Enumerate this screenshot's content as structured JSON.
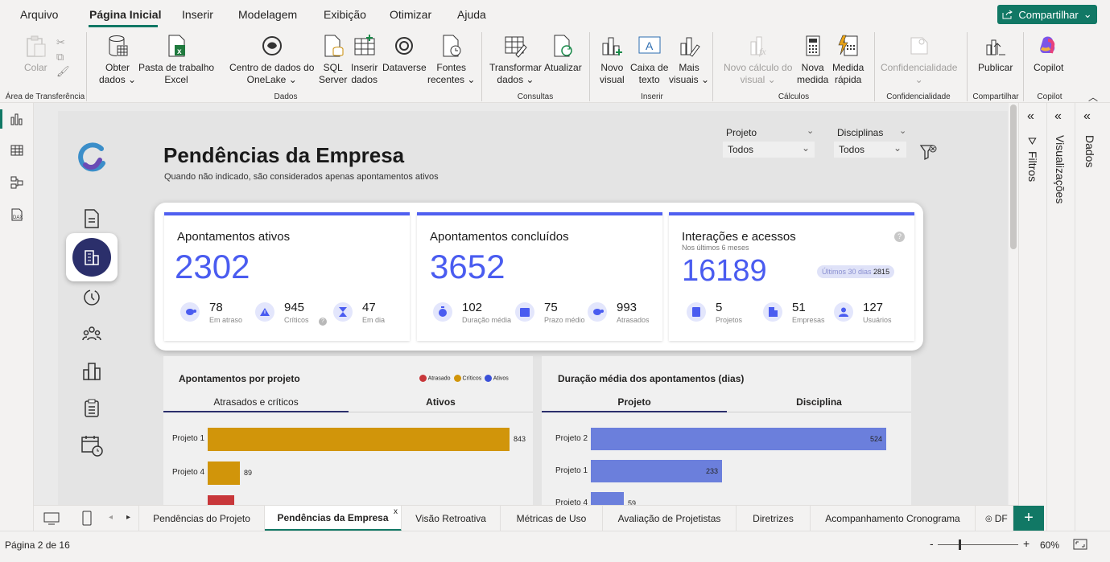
{
  "menu": {
    "items": [
      "Arquivo",
      "Página Inicial",
      "Inserir",
      "Modelagem",
      "Exibição",
      "Otimizar",
      "Ajuda"
    ],
    "share": "Compartilhar"
  },
  "ribbon": {
    "buttons": [
      {
        "l1": "Colar",
        "l2": "",
        "icon": "paste-icon"
      },
      {
        "l1": "Obter",
        "l2": "dados ⌄",
        "icon": "database-icon"
      },
      {
        "l1": "Pasta de trabalho",
        "l2": "Excel",
        "icon": "excel-icon"
      },
      {
        "l1": "Centro de dados do",
        "l2": "OneLake ⌄",
        "icon": "onelake-icon"
      },
      {
        "l1": "SQL",
        "l2": "Server",
        "icon": "sql-server-icon"
      },
      {
        "l1": "Inserir",
        "l2": "dados",
        "icon": "table-icon"
      },
      {
        "l1": "Dataverse",
        "l2": "",
        "icon": "dataverse-icon"
      },
      {
        "l1": "Fontes",
        "l2": "recentes ⌄",
        "icon": "recent-icon"
      },
      {
        "l1": "Transformar",
        "l2": "dados ⌄",
        "icon": "transform-icon"
      },
      {
        "l1": "Atualizar",
        "l2": "",
        "icon": "refresh-icon"
      },
      {
        "l1": "Novo",
        "l2": "visual",
        "icon": "new-visual-icon"
      },
      {
        "l1": "Caixa de",
        "l2": "texto",
        "icon": "textbox-icon"
      },
      {
        "l1": "Mais",
        "l2": "visuais ⌄",
        "icon": "more-visuals-icon"
      },
      {
        "l1": "Novo cálculo do",
        "l2": "visual ⌄",
        "icon": "visual-calc-icon"
      },
      {
        "l1": "Nova",
        "l2": "medida",
        "icon": "measure-icon"
      },
      {
        "l1": "Medida",
        "l2": "rápida",
        "icon": "quick-measure-icon"
      },
      {
        "l1": "Confidencialidade",
        "l2": "⌄",
        "icon": "sensitivity-icon"
      },
      {
        "l1": "Publicar",
        "l2": "",
        "icon": "publish-icon"
      },
      {
        "l1": "Copilot",
        "l2": "",
        "icon": "copilot-icon"
      }
    ],
    "groups": [
      "Área de Transferência",
      "Dados",
      "Consultas",
      "Inserir",
      "Cálculos",
      "Confidencialidade",
      "Compartilhar",
      "Copilot"
    ]
  },
  "report": {
    "title": "Pendências da Empresa",
    "subtitle": "Quando não indicado, são considerados apenas apontamentos ativos",
    "filters": [
      {
        "label": "Projeto",
        "value": "Todos"
      },
      {
        "label": "Disciplinas",
        "value": "Todos"
      }
    ]
  },
  "kpis": [
    {
      "title": "Apontamentos ativos",
      "subtitle": "",
      "value": "2302",
      "minis": [
        {
          "num": "78",
          "lbl": "Em atraso"
        },
        {
          "num": "945",
          "lbl": "Críticos"
        },
        {
          "num": "47",
          "lbl": "Em dia"
        }
      ]
    },
    {
      "title": "Apontamentos concluídos",
      "subtitle": "",
      "value": "3652",
      "minis": [
        {
          "num": "102",
          "lbl": "Duração média"
        },
        {
          "num": "75",
          "lbl": "Prazo médio"
        },
        {
          "num": "993",
          "lbl": "Atrasados"
        }
      ]
    },
    {
      "title": "Interações e acessos",
      "subtitle": "Nos últimos 6 meses",
      "value": "16189",
      "badge_label": "Últimos 30 dias",
      "badge_value": "2815",
      "minis": [
        {
          "num": "5",
          "lbl": "Projetos"
        },
        {
          "num": "51",
          "lbl": "Empresas"
        },
        {
          "num": "127",
          "lbl": "Usuários"
        }
      ]
    }
  ],
  "panel1": {
    "title": "Apontamentos por projeto",
    "legend": [
      "Atrasado",
      "Críticos",
      "Ativos"
    ],
    "tabs": [
      "Atrasados e críticos",
      "Ativos"
    ]
  },
  "panel2": {
    "title": "Duração média dos apontamentos (dias)",
    "tabs": [
      "Projeto",
      "Disciplina"
    ]
  },
  "chart_data": [
    {
      "type": "bar",
      "title": "Apontamentos por projeto",
      "categories": [
        "Projeto 1",
        "Projeto 4"
      ],
      "series": [
        {
          "name": "Críticos",
          "values": [
            843,
            89
          ]
        }
      ],
      "colors": [
        "#d1950a",
        "#c8373a"
      ]
    },
    {
      "type": "bar",
      "title": "Duração média dos apontamentos (dias)",
      "categories": [
        "Projeto 2",
        "Projeto 1",
        "Projeto 4"
      ],
      "values": [
        524,
        233,
        59
      ],
      "color": "#6b7fdc"
    }
  ],
  "rightpanes": [
    "Filtros",
    "Visualizações",
    "Dados"
  ],
  "pagetabs": [
    "Pendências do Projeto",
    "Pendências da Empresa",
    "Visão Retroativa",
    "Métricas de Uso",
    "Avaliação de Projetistas",
    "Diretrizes",
    "Acompanhamento Cronograma",
    "DF"
  ],
  "status": {
    "page": "Página 2 de 16",
    "zoom": "60%"
  }
}
